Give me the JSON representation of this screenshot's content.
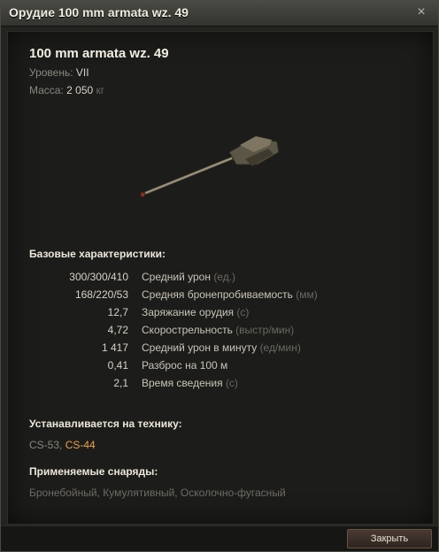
{
  "window": {
    "title": "Орудие 100 mm armata wz. 49",
    "close_glyph": "×"
  },
  "gun": {
    "name": "100 mm armata wz. 49",
    "tier_label": "Уровень:",
    "tier_value": "VII",
    "mass_label": "Масса:",
    "mass_value": "2 050",
    "mass_unit": "кг"
  },
  "base_stats": {
    "heading": "Базовые характеристики:",
    "rows": [
      {
        "value": "300/300/410",
        "label": "Средний урон",
        "unit": "(ед.)"
      },
      {
        "value": "168/220/53",
        "label": "Средняя бронепробиваемость",
        "unit": "(мм)"
      },
      {
        "value": "12,7",
        "label": "Заряжание орудия",
        "unit": "(с)"
      },
      {
        "value": "4,72",
        "label": "Скорострельность",
        "unit": "(выстр/мин)"
      },
      {
        "value": "1 417",
        "label": "Средний урон в минуту",
        "unit": "(ед/мин)"
      },
      {
        "value": "0,41",
        "label": "Разброс на 100 м",
        "unit": ""
      },
      {
        "value": "2,1",
        "label": "Время сведения",
        "unit": "(с)"
      }
    ]
  },
  "vehicles": {
    "heading": "Устанавливается на технику:",
    "item1": "CS-53",
    "separator": ", ",
    "item2": "CS-44"
  },
  "shells": {
    "heading": "Применяемые снаряды:",
    "list": "Бронебойный, Кумулятивный, Осколочно-фугасный"
  },
  "footer": {
    "close_label": "Закрыть"
  },
  "colors": {
    "accent": "#e8a448",
    "background": "#1c1c1a"
  }
}
